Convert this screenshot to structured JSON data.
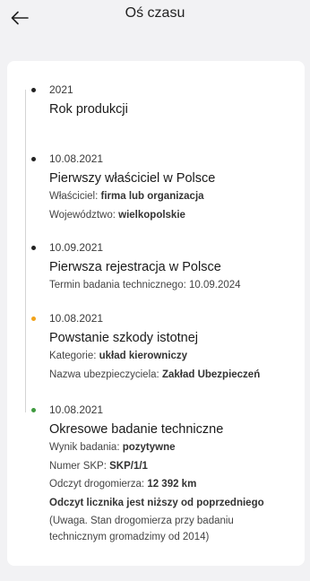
{
  "header": {
    "title": "Oś czasu"
  },
  "colors": {
    "dot_default": "#222222",
    "dot_damage": "#f2a31b",
    "dot_inspection": "#3f9a3f"
  },
  "events": [
    {
      "date": "2021",
      "title": "Rok produkcji",
      "dot": "default"
    },
    {
      "date": "10.08.2021",
      "title": "Pierwszy właściciel w Polsce",
      "dot": "default",
      "owner_label": "Właściciel:",
      "owner_value": "firma lub organizacja",
      "region_label": "Województwo:",
      "region_value": "wielkopolskie"
    },
    {
      "date": "10.09.2021",
      "title": "Pierwsza rejestracja w Polsce",
      "dot": "default",
      "inspection_term": "Termin badania technicznego: 10.09.2024"
    },
    {
      "date": "10.08.2021",
      "title": "Powstanie szkody istotnej",
      "dot": "damage",
      "category_label": "Kategorie:",
      "category_value": "układ kierowniczy",
      "insurer_label": "Nazwa ubezpieczyciela:",
      "insurer_value": "Zakład Ubezpieczeń"
    },
    {
      "date": "10.08.2021",
      "title": "Okresowe badanie techniczne",
      "dot": "inspection",
      "result_label": "Wynik badania:",
      "result_value": "pozytywne",
      "skp_label": "Numer SKP:",
      "skp_value": "SKP/1/1",
      "odometer_label": "Odczyt drogomierza:",
      "odometer_value": "12 392 km",
      "warning": "Odczyt licznika jest niższy od poprzedniego",
      "note_line1": "(Uwaga. Stan drogomierza przy badaniu",
      "note_line2": "technicznym gromadzimy od 2014)"
    }
  ]
}
